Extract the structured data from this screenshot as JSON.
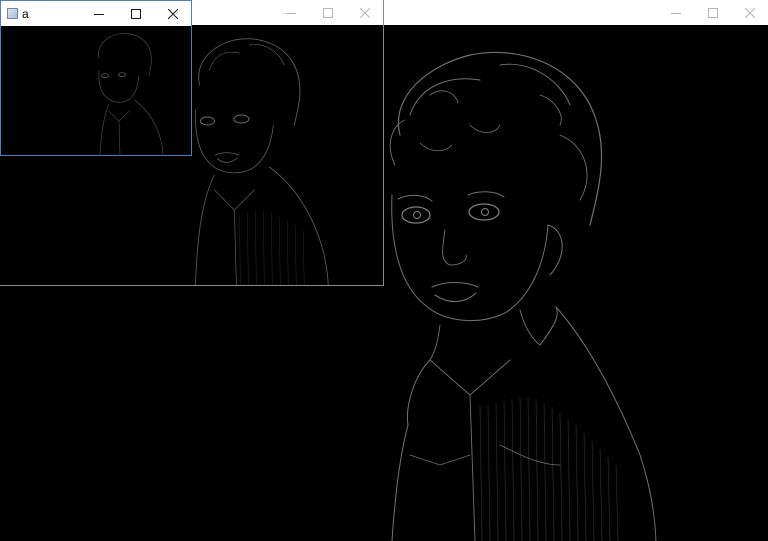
{
  "windows": {
    "large": {
      "title": "",
      "controls": [
        "minimize-icon",
        "maximize-icon",
        "close-icon"
      ]
    },
    "medium": {
      "title": "",
      "controls": [
        "minimize-icon",
        "maximize-icon",
        "close-icon"
      ]
    },
    "small": {
      "title": "a",
      "icon": "app-window-icon",
      "active": true,
      "controls": [
        "minimize-icon",
        "maximize-icon",
        "close-icon"
      ]
    }
  },
  "colors": {
    "titlebar": "#ffffff",
    "active_border": "#4a7fc1",
    "inactive_border": "#8c8c8c",
    "image_background": "#000000",
    "edge_lines": "#cfcfcf"
  }
}
